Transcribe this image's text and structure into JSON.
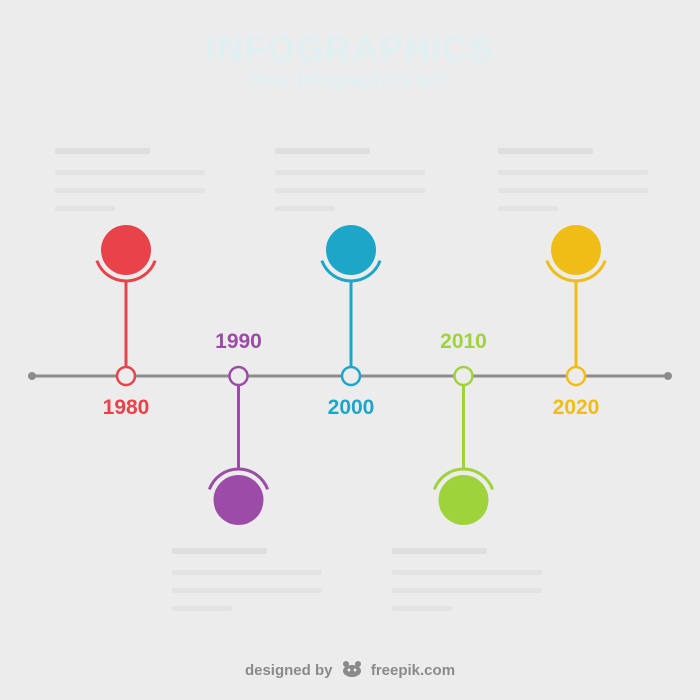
{
  "header": {
    "title": "INFOGRAPHICS",
    "subtitle": "Your infographics text"
  },
  "colors": {
    "axis": "#8c8c8c",
    "background": "#ececec"
  },
  "timeline": [
    {
      "year": "1980",
      "color": "#e8434b",
      "side": "top"
    },
    {
      "year": "1990",
      "color": "#9b4ca6",
      "side": "bottom"
    },
    {
      "year": "2000",
      "color": "#1ea6c9",
      "side": "top"
    },
    {
      "year": "2010",
      "color": "#9fd33b",
      "side": "bottom"
    },
    {
      "year": "2020",
      "color": "#f0bd16",
      "side": "top"
    }
  ],
  "credit": {
    "designed_by": "designed by",
    "site": "freepik.com",
    "logo_icon": "freepik-logo-icon"
  }
}
